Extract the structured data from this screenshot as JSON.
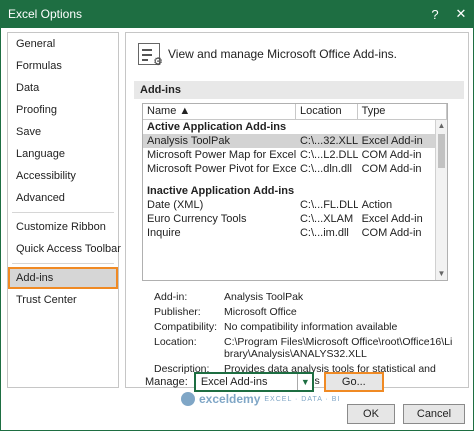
{
  "window": {
    "title": "Excel Options",
    "help": "?",
    "close": "✕"
  },
  "sidebar": {
    "items": [
      {
        "label": "General"
      },
      {
        "label": "Formulas"
      },
      {
        "label": "Data"
      },
      {
        "label": "Proofing"
      },
      {
        "label": "Save"
      },
      {
        "label": "Language"
      },
      {
        "label": "Accessibility"
      },
      {
        "label": "Advanced"
      },
      {
        "label": "Customize Ribbon"
      },
      {
        "label": "Quick Access Toolbar"
      },
      {
        "label": "Add-ins"
      },
      {
        "label": "Trust Center"
      }
    ],
    "selected": "Add-ins"
  },
  "main": {
    "header_text": "View and manage Microsoft Office Add-ins.",
    "section_label": "Add-ins",
    "table": {
      "columns": [
        "Name ▲",
        "Location",
        "Type"
      ],
      "groups": [
        {
          "label": "Active Application Add-ins",
          "rows": [
            {
              "name": "Analysis ToolPak",
              "location": "C:\\...32.XLL",
              "type": "Excel Add-in",
              "selected": true
            },
            {
              "name": "Microsoft Power Map for Excel",
              "location": "C:\\...L2.DLL",
              "type": "COM Add-in"
            },
            {
              "name": "Microsoft Power Pivot for Excel",
              "location": "C:\\...dln.dll",
              "type": "COM Add-in"
            }
          ]
        },
        {
          "label": "Inactive Application Add-ins",
          "rows": [
            {
              "name": "Date (XML)",
              "location": "C:\\...FL.DLL",
              "type": "Action"
            },
            {
              "name": "Euro Currency Tools",
              "location": "C:\\...XLAM",
              "type": "Excel Add-in"
            },
            {
              "name": "Inquire",
              "location": "C:\\...im.dll",
              "type": "COM Add-in"
            }
          ]
        }
      ]
    },
    "details": {
      "addin_label": "Add-in:",
      "addin_value": "Analysis ToolPak",
      "publisher_label": "Publisher:",
      "publisher_value": "Microsoft Office",
      "compat_label": "Compatibility:",
      "compat_value": "No compatibility information available",
      "location_label": "Location:",
      "location_value": "C:\\Program Files\\Microsoft Office\\root\\Office16\\Library\\Analysis\\ANALYS32.XLL",
      "desc_label": "Description:",
      "desc_value": "Provides data analysis tools for statistical and engineering analysis"
    },
    "manage_label": "Manage:",
    "manage_value": "Excel Add-ins",
    "go_label": "Go..."
  },
  "footer": {
    "ok_label": "OK",
    "cancel_label": "Cancel",
    "watermark_title": "exceldemy",
    "watermark_sub": "EXCEL · DATA · BI"
  },
  "colors": {
    "titlebar": "#1e6e42",
    "highlight": "#f08a24",
    "selected_bg": "#d6d6d6"
  }
}
